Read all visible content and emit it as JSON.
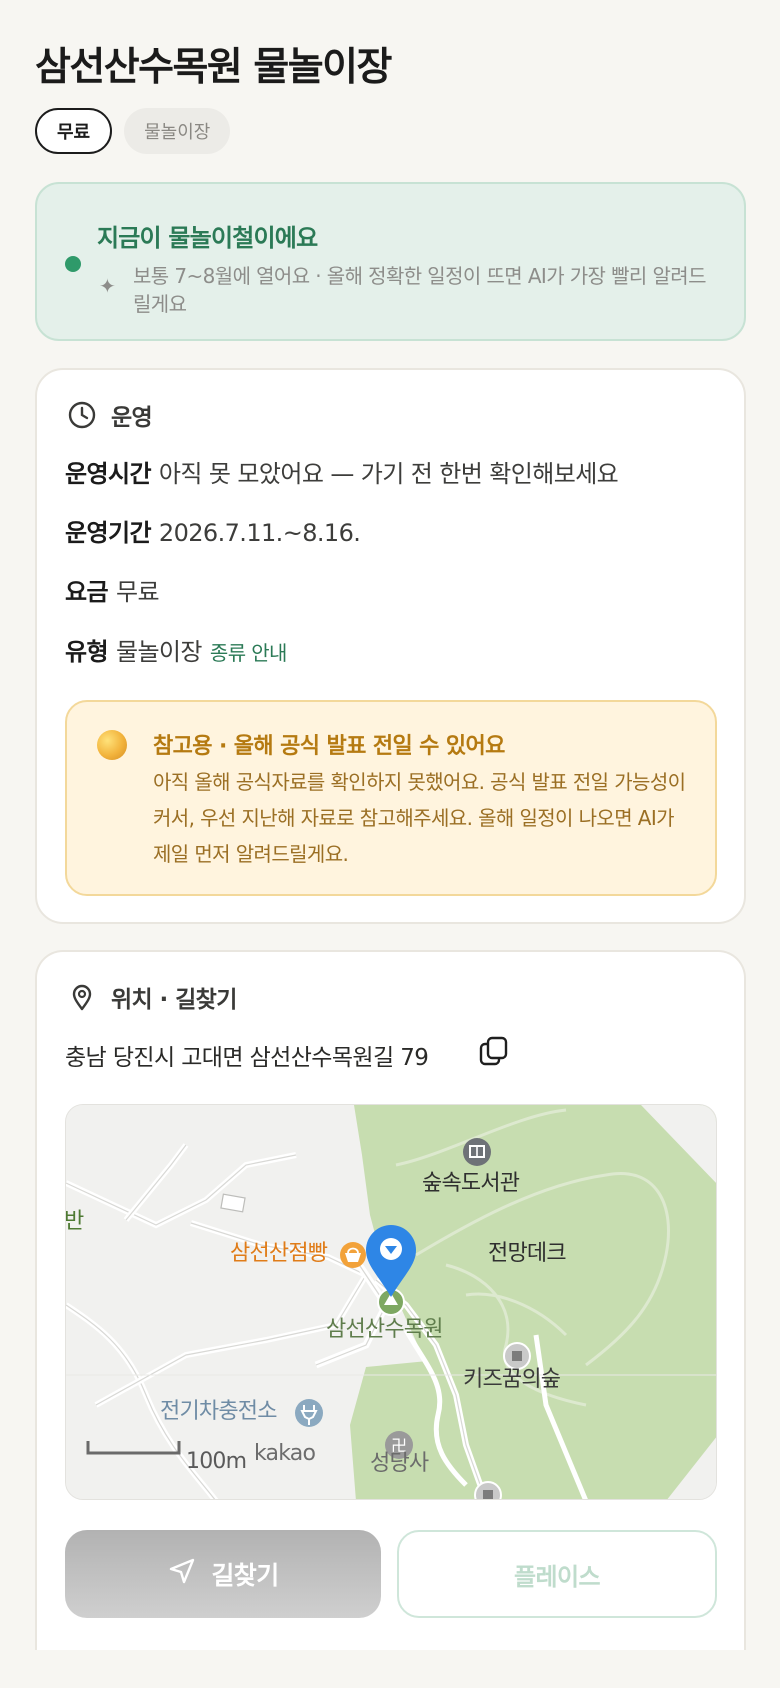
{
  "header": {
    "title": "삼선산수목원 물놀이장",
    "chips": {
      "free": "무료",
      "type": "물놀이장"
    }
  },
  "season_banner": {
    "headline": "지금이 물놀이철이에요",
    "note": "보통 7~8월에 열어요 · 올해 정확한 일정이 뜨면 AI가 가장 빨리 알려드릴게요",
    "accent_color": "#2f9a6a"
  },
  "operation": {
    "section_label": "운영",
    "rows": {
      "hours": {
        "key": "운영시간",
        "value": "아직 못 모았어요 — 가기 전 한번 확인해보세요"
      },
      "period": {
        "key": "운영기간",
        "value": "2026.7.11.~8.16."
      },
      "fee": {
        "key": "요금",
        "value": "무료"
      },
      "type": {
        "key": "유형",
        "value": "물놀이장",
        "link": "종류 안내"
      }
    },
    "caution": {
      "title": "참고용 · 올해 공식 발표 전일 수 있어요",
      "body": "아직 올해 공식자료를 확인하지 못했어요. 공식 발표 전일 가능성이 커서, 우선 지난해 자료로 참고해주세요. 올해 일정이 나오면 AI가 제일 먼저 알려드릴게요."
    }
  },
  "location": {
    "section_label": "위치 · 길찾기",
    "address": "충남 당진시 고대면 삼선산수목원길 79",
    "copy_icon": "copy-icon",
    "map": {
      "labels": {
        "library": "숲속도서관",
        "viewdeck": "전망데크",
        "bakery": "삼선산점빵",
        "arboretum": "삼선산수목원",
        "kids_forest": "키즈꿈의숲",
        "ev": "전기차충전소",
        "temple": "성당사",
        "edge": "반",
        "scale": "100m",
        "brand": "kakao"
      }
    },
    "buttons": {
      "navigate": "길찾기",
      "place": "플레이스"
    }
  }
}
